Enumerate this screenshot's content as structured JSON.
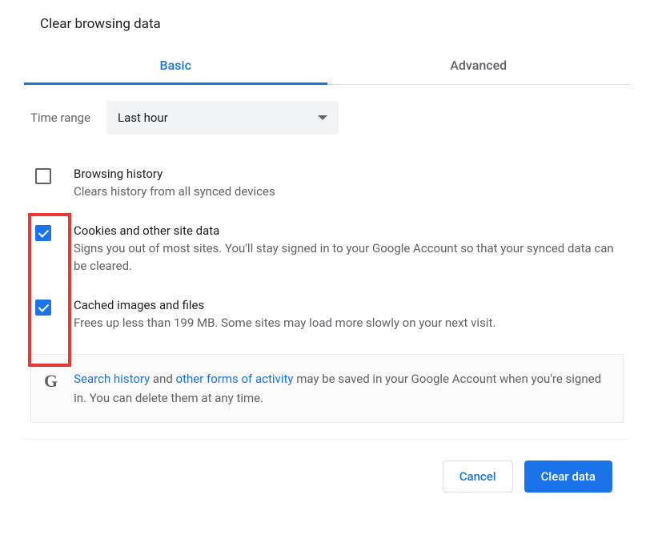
{
  "dialog": {
    "title": "Clear browsing data"
  },
  "tabs": {
    "basic": "Basic",
    "advanced": "Advanced"
  },
  "time_range": {
    "label": "Time range",
    "selected": "Last hour"
  },
  "options": {
    "browsing_history": {
      "title": "Browsing history",
      "desc": "Clears history from all synced devices",
      "checked": false
    },
    "cookies": {
      "title": "Cookies and other site data",
      "desc": "Signs you out of most sites. You'll stay signed in to your Google Account so that your synced data can be cleared.",
      "checked": true
    },
    "cache": {
      "title": "Cached images and files",
      "desc": "Frees up less than 199 MB. Some sites may load more slowly on your next visit.",
      "checked": true
    }
  },
  "info": {
    "text_prefix": "",
    "link1": "Search history",
    "mid1": " and ",
    "link2": "other forms of activity",
    "suffix": " may be saved in your Google Account when you're signed in. You can delete them at any time."
  },
  "buttons": {
    "cancel": "Cancel",
    "clear": "Clear data"
  }
}
